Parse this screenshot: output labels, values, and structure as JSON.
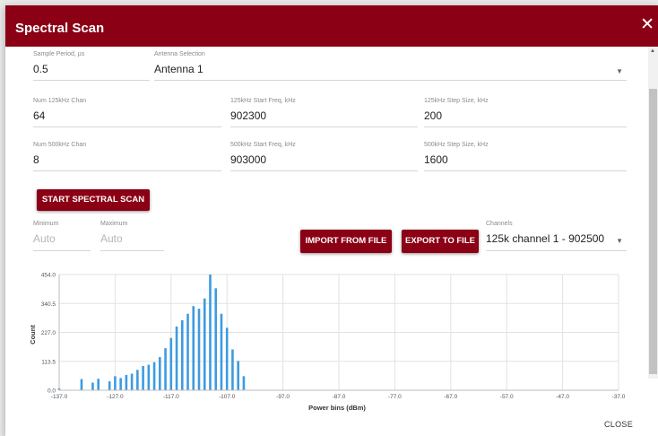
{
  "dialog": {
    "title": "Spectral Scan",
    "close_label": "CLOSE"
  },
  "fields": {
    "sample_period": {
      "label": "Sample Period, µs",
      "value": "0.5"
    },
    "antenna": {
      "label": "Antenna Selection",
      "value": "Antenna 1"
    },
    "num_125": {
      "label": "Num 125kHz Chan",
      "value": "64"
    },
    "start_125": {
      "label": "125kHz Start Freq, kHz",
      "value": "902300"
    },
    "step_125": {
      "label": "125kHz Step Size, kHz",
      "value": "200"
    },
    "num_500": {
      "label": "Num 500kHz Chan",
      "value": "8"
    },
    "start_500": {
      "label": "500kHz Start Freq, kHz",
      "value": "903000"
    },
    "step_500": {
      "label": "500kHz Step Size, kHz",
      "value": "1600"
    },
    "minimum": {
      "label": "Minimum",
      "placeholder": "Auto"
    },
    "maximum": {
      "label": "Maximum",
      "placeholder": "Auto"
    },
    "channels": {
      "label": "Channels",
      "value": "125k channel 1 - 902500"
    }
  },
  "buttons": {
    "start_scan": "START SPECTRAL SCAN",
    "import": "IMPORT FROM FILE",
    "export": "EXPORT TO FILE"
  },
  "colors": {
    "accent": "#8b0014",
    "bar": "#3d9be0"
  },
  "chart_data": {
    "type": "bar",
    "xlabel": "Power bins (dBm)",
    "ylabel": "Count",
    "xlim": [
      -137.0,
      -37.0
    ],
    "ylim": [
      0.0,
      454.0
    ],
    "x_ticks": [
      "-137.0",
      "-127.0",
      "-117.0",
      "-107.0",
      "-97.0",
      "-87.0",
      "-77.0",
      "-67.0",
      "-57.0",
      "-47.0",
      "-37.0"
    ],
    "y_ticks": [
      "0.0",
      "113.5",
      "227.0",
      "340.5",
      "454.0"
    ],
    "grid": true,
    "x": [
      -137,
      -133,
      -131,
      -130,
      -128,
      -127,
      -126,
      -125,
      -124,
      -123,
      -122,
      -121,
      -120,
      -119,
      -118,
      -117,
      -116,
      -115,
      -114,
      -113,
      -112,
      -111,
      -110,
      -109,
      -108,
      -107,
      -106,
      -105,
      -104
    ],
    "values": [
      8,
      44,
      30,
      45,
      35,
      55,
      48,
      60,
      65,
      80,
      95,
      100,
      110,
      130,
      165,
      205,
      250,
      275,
      300,
      330,
      320,
      360,
      454,
      400,
      300,
      245,
      160,
      115,
      55
    ]
  }
}
